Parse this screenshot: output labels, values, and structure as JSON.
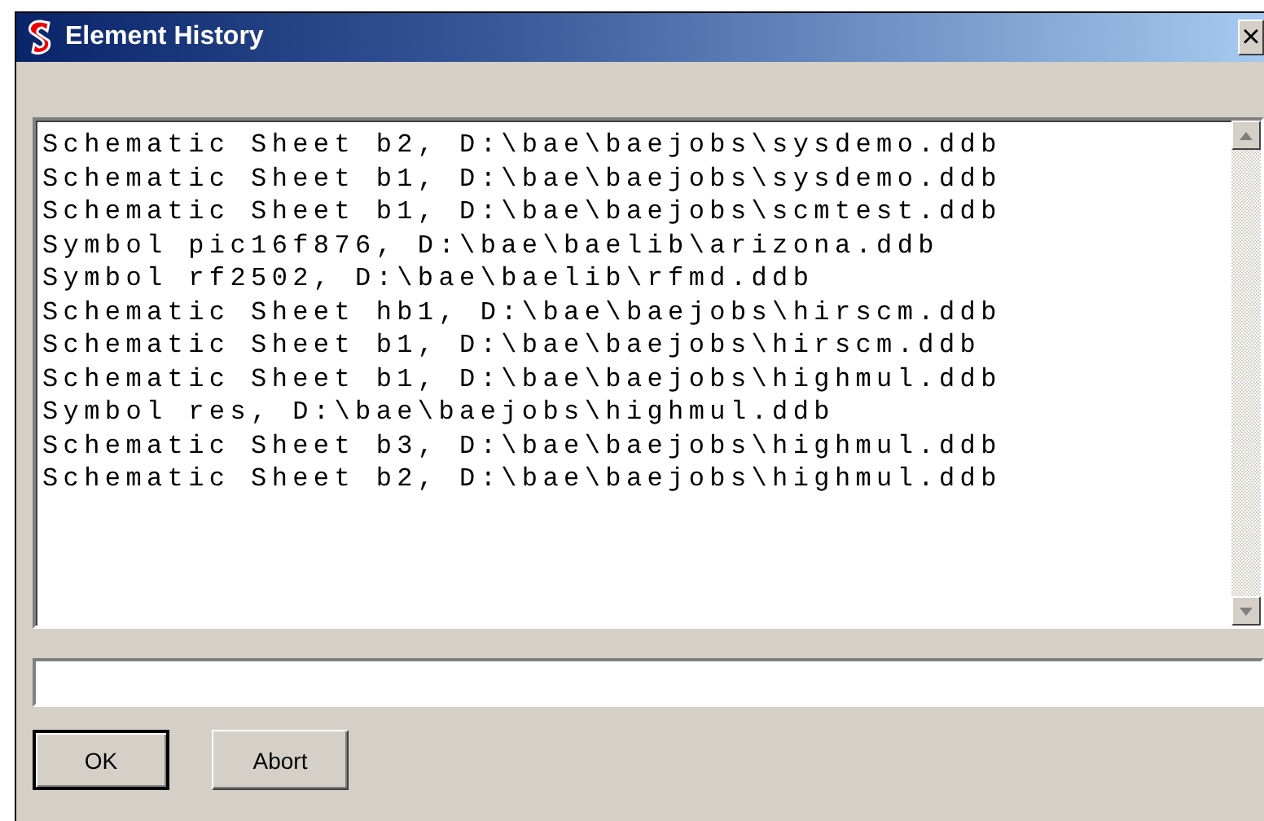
{
  "window": {
    "title": "Element History",
    "close": "×"
  },
  "history": [
    "Schematic Sheet b2, D:\\bae\\baejobs\\sysdemo.ddb",
    "Schematic Sheet b1, D:\\bae\\baejobs\\sysdemo.ddb",
    "Schematic Sheet b1, D:\\bae\\baejobs\\scmtest.ddb",
    "Symbol pic16f876, D:\\bae\\baelib\\arizona.ddb",
    "Symbol rf2502, D:\\bae\\baelib\\rfmd.ddb",
    "Schematic Sheet hb1, D:\\bae\\baejobs\\hirscm.ddb",
    "Schematic Sheet b1, D:\\bae\\baejobs\\hirscm.ddb",
    "Schematic Sheet b1, D:\\bae\\baejobs\\highmul.ddb",
    "Symbol res, D:\\bae\\baejobs\\highmul.ddb",
    "Schematic Sheet b3, D:\\bae\\baejobs\\highmul.ddb",
    "Schematic Sheet b2, D:\\bae\\baejobs\\highmul.ddb"
  ],
  "buttons": [
    {
      "label": "OK",
      "default": true
    },
    {
      "label": "Abort",
      "default": false
    }
  ]
}
